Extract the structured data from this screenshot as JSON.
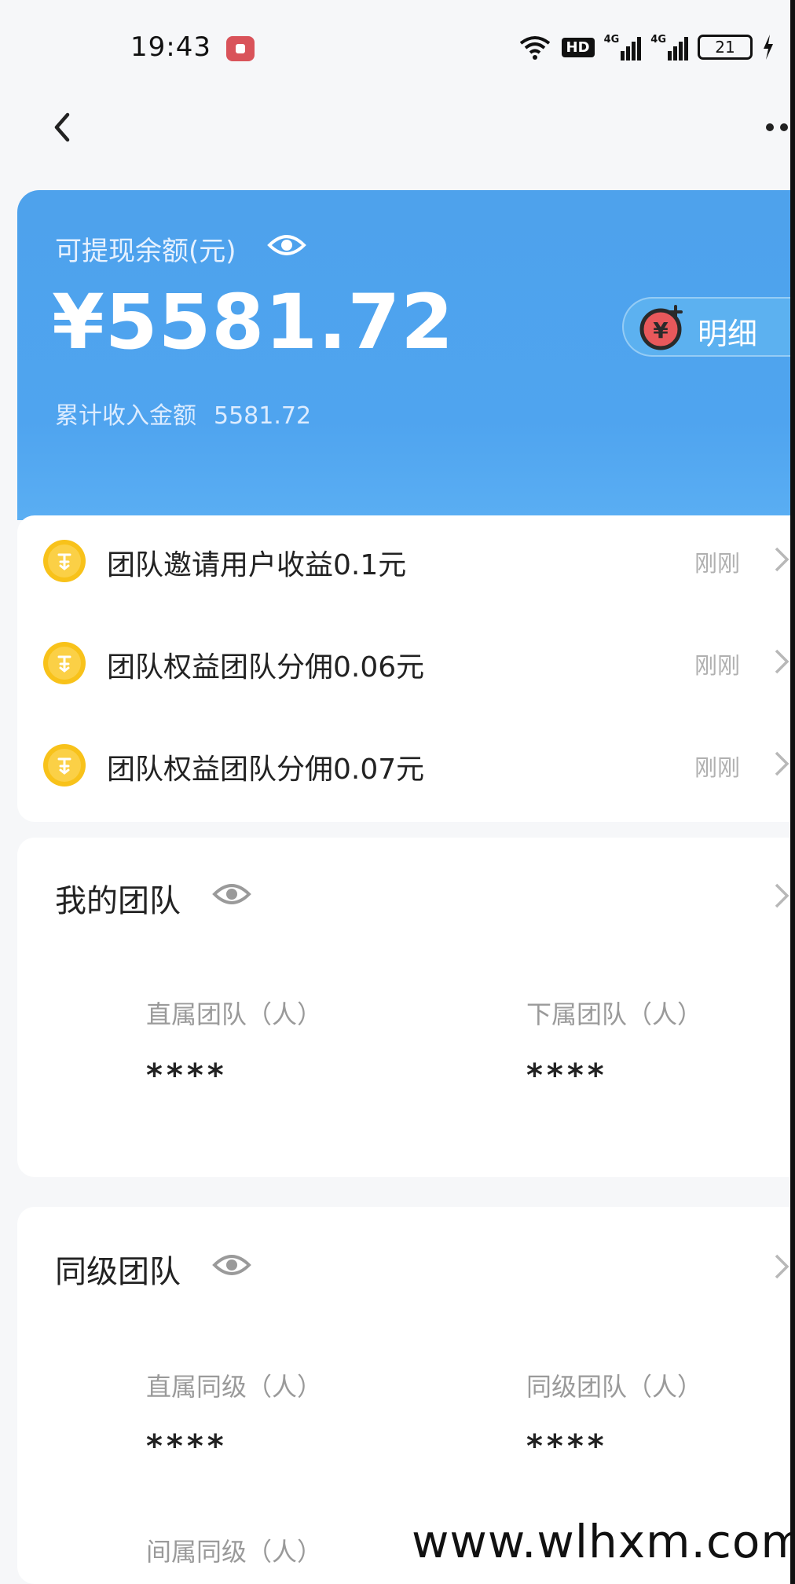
{
  "status_bar": {
    "time": "19:43",
    "hd": "HD",
    "signal1": "4G",
    "signal2": "4G",
    "battery": "21"
  },
  "balance": {
    "label": "可提现余额(元)",
    "amount": "¥5581.72",
    "detail_label": "明细",
    "cumulative_label": "累计收入金额",
    "cumulative_value": "5581.72"
  },
  "earnings": [
    {
      "text": "团队邀请用户收益0.1元",
      "time": "刚刚"
    },
    {
      "text": "团队权益团队分佣0.06元",
      "time": "刚刚"
    },
    {
      "text": "团队权益团队分佣0.07元",
      "time": "刚刚"
    }
  ],
  "my_team": {
    "title": "我的团队",
    "stats": [
      {
        "label": "直属团队（人）",
        "value": "****"
      },
      {
        "label": "下属团队（人）",
        "value": "****"
      }
    ]
  },
  "peer_team": {
    "title": "同级团队",
    "stats": [
      {
        "label": "直属同级（人）",
        "value": "****"
      },
      {
        "label": "同级团队（人）",
        "value": "****"
      },
      {
        "label": "间属同级（人）",
        "value": ""
      }
    ]
  },
  "watermark": "www.wlhxm.com",
  "colors": {
    "card_blue": "#4fa4ef",
    "coin_gold": "#f8c21a",
    "muted_text": "#9a9a9a"
  }
}
